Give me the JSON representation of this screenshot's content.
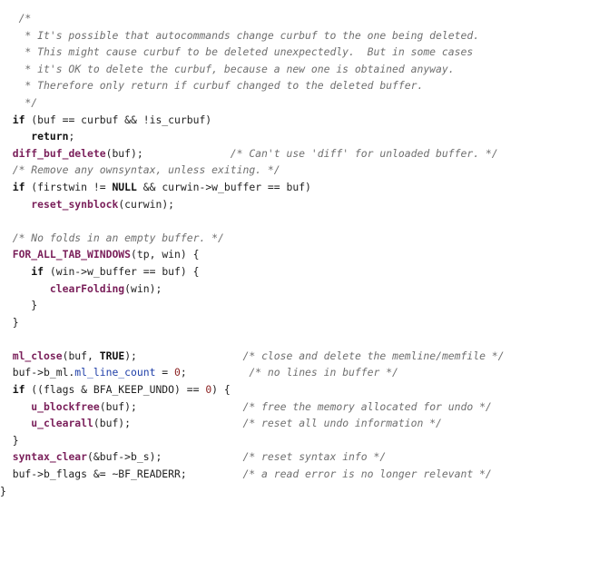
{
  "editor": {
    "colors": {
      "background": "#ffffff",
      "text": "#1f1f1f",
      "comment": "#6f6f6f",
      "keyword": "#111111",
      "function": "#7a1f5a",
      "number": "#8a1f1f",
      "field": "#1f3fa8"
    },
    "lines": [
      [
        {
          "t": "comment",
          "s": "   /*"
        }
      ],
      [
        {
          "t": "comment",
          "s": "    * It's possible that autocommands change curbuf to the one being deleted."
        }
      ],
      [
        {
          "t": "comment",
          "s": "    * This might cause curbuf to be deleted unexpectedly.  But in some cases"
        }
      ],
      [
        {
          "t": "comment",
          "s": "    * it's OK to delete the curbuf, because a new one is obtained anyway."
        }
      ],
      [
        {
          "t": "comment",
          "s": "    * Therefore only return if curbuf changed to the deleted buffer."
        }
      ],
      [
        {
          "t": "comment",
          "s": "    */"
        }
      ],
      [
        {
          "t": "plain",
          "s": "  "
        },
        {
          "t": "keyword",
          "s": "if"
        },
        {
          "t": "plain",
          "s": " (buf == curbuf && !is_curbuf)"
        }
      ],
      [
        {
          "t": "plain",
          "s": "     "
        },
        {
          "t": "keyword",
          "s": "return"
        },
        {
          "t": "plain",
          "s": ";"
        }
      ],
      [
        {
          "t": "plain",
          "s": "  "
        },
        {
          "t": "func",
          "s": "diff_buf_delete"
        },
        {
          "t": "plain",
          "s": "(buf);              "
        },
        {
          "t": "comment",
          "s": "/* Can't use 'diff' for unloaded buffer. */"
        }
      ],
      [
        {
          "t": "plain",
          "s": "  "
        },
        {
          "t": "comment",
          "s": "/* Remove any ownsyntax, unless exiting. */"
        }
      ],
      [
        {
          "t": "plain",
          "s": "  "
        },
        {
          "t": "keyword",
          "s": "if"
        },
        {
          "t": "plain",
          "s": " (firstwin != "
        },
        {
          "t": "keyword",
          "s": "NULL"
        },
        {
          "t": "plain",
          "s": " && curwin->w_buffer == buf)"
        }
      ],
      [
        {
          "t": "plain",
          "s": "     "
        },
        {
          "t": "func",
          "s": "reset_synblock"
        },
        {
          "t": "plain",
          "s": "(curwin);"
        }
      ],
      [],
      [
        {
          "t": "plain",
          "s": "  "
        },
        {
          "t": "comment",
          "s": "/* No folds in an empty buffer. */"
        }
      ],
      [
        {
          "t": "plain",
          "s": "  "
        },
        {
          "t": "func",
          "s": "FOR_ALL_TAB_WINDOWS"
        },
        {
          "t": "plain",
          "s": "(tp, win) {"
        }
      ],
      [
        {
          "t": "plain",
          "s": "     "
        },
        {
          "t": "keyword",
          "s": "if"
        },
        {
          "t": "plain",
          "s": " (win->w_buffer == buf) {"
        }
      ],
      [
        {
          "t": "plain",
          "s": "        "
        },
        {
          "t": "func",
          "s": "clearFolding"
        },
        {
          "t": "plain",
          "s": "(win);"
        }
      ],
      [
        {
          "t": "plain",
          "s": "     }"
        }
      ],
      [
        {
          "t": "plain",
          "s": "  }"
        }
      ],
      [],
      [
        {
          "t": "plain",
          "s": "  "
        },
        {
          "t": "func",
          "s": "ml_close"
        },
        {
          "t": "plain",
          "s": "(buf, "
        },
        {
          "t": "keyword",
          "s": "TRUE"
        },
        {
          "t": "plain",
          "s": ");                 "
        },
        {
          "t": "comment",
          "s": "/* close and delete the memline/memfile */"
        }
      ],
      [
        {
          "t": "plain",
          "s": "  buf->b_ml."
        },
        {
          "t": "field",
          "s": "ml_line_count"
        },
        {
          "t": "plain",
          "s": " = "
        },
        {
          "t": "number",
          "s": "0"
        },
        {
          "t": "plain",
          "s": ";          "
        },
        {
          "t": "comment",
          "s": "/* no lines in buffer */"
        }
      ],
      [
        {
          "t": "plain",
          "s": "  "
        },
        {
          "t": "keyword",
          "s": "if"
        },
        {
          "t": "plain",
          "s": " ((flags & BFA_KEEP_UNDO) == "
        },
        {
          "t": "number",
          "s": "0"
        },
        {
          "t": "plain",
          "s": ") {"
        }
      ],
      [
        {
          "t": "plain",
          "s": "     "
        },
        {
          "t": "func",
          "s": "u_blockfree"
        },
        {
          "t": "plain",
          "s": "(buf);                 "
        },
        {
          "t": "comment",
          "s": "/* free the memory allocated for undo */"
        }
      ],
      [
        {
          "t": "plain",
          "s": "     "
        },
        {
          "t": "func",
          "s": "u_clearall"
        },
        {
          "t": "plain",
          "s": "(buf);                  "
        },
        {
          "t": "comment",
          "s": "/* reset all undo information */"
        }
      ],
      [
        {
          "t": "plain",
          "s": "  }"
        }
      ],
      [
        {
          "t": "plain",
          "s": "  "
        },
        {
          "t": "func",
          "s": "syntax_clear"
        },
        {
          "t": "plain",
          "s": "(&buf->b_s);             "
        },
        {
          "t": "comment",
          "s": "/* reset syntax info */"
        }
      ],
      [
        {
          "t": "plain",
          "s": "  buf->b_flags &= ~BF_READERR;         "
        },
        {
          "t": "comment",
          "s": "/* a read error is no longer relevant */"
        }
      ],
      [
        {
          "t": "plain",
          "s": "}"
        }
      ]
    ]
  }
}
